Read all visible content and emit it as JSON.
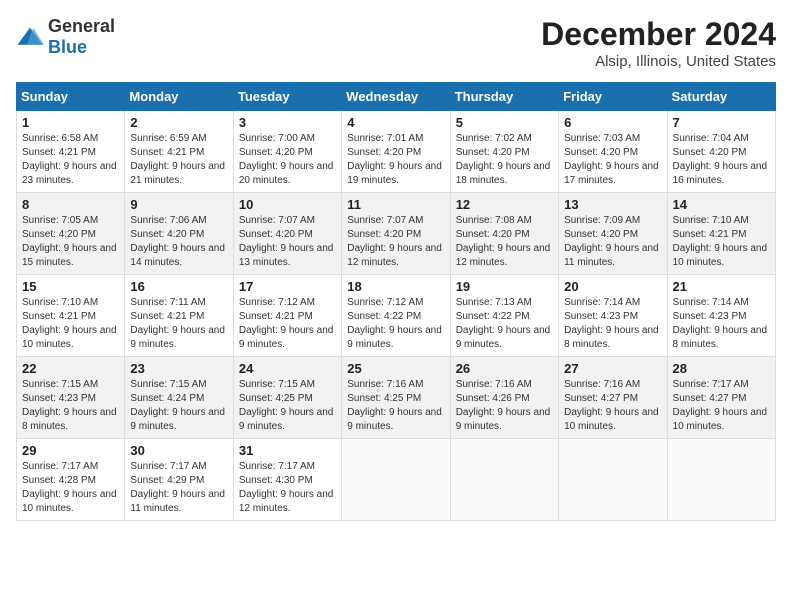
{
  "header": {
    "logo_general": "General",
    "logo_blue": "Blue",
    "month_title": "December 2024",
    "location": "Alsip, Illinois, United States"
  },
  "days_of_week": [
    "Sunday",
    "Monday",
    "Tuesday",
    "Wednesday",
    "Thursday",
    "Friday",
    "Saturday"
  ],
  "weeks": [
    [
      {
        "day": "1",
        "sunrise": "6:58 AM",
        "sunset": "4:21 PM",
        "daylight": "9 hours and 23 minutes."
      },
      {
        "day": "2",
        "sunrise": "6:59 AM",
        "sunset": "4:21 PM",
        "daylight": "9 hours and 21 minutes."
      },
      {
        "day": "3",
        "sunrise": "7:00 AM",
        "sunset": "4:20 PM",
        "daylight": "9 hours and 20 minutes."
      },
      {
        "day": "4",
        "sunrise": "7:01 AM",
        "sunset": "4:20 PM",
        "daylight": "9 hours and 19 minutes."
      },
      {
        "day": "5",
        "sunrise": "7:02 AM",
        "sunset": "4:20 PM",
        "daylight": "9 hours and 18 minutes."
      },
      {
        "day": "6",
        "sunrise": "7:03 AM",
        "sunset": "4:20 PM",
        "daylight": "9 hours and 17 minutes."
      },
      {
        "day": "7",
        "sunrise": "7:04 AM",
        "sunset": "4:20 PM",
        "daylight": "9 hours and 16 minutes."
      }
    ],
    [
      {
        "day": "8",
        "sunrise": "7:05 AM",
        "sunset": "4:20 PM",
        "daylight": "9 hours and 15 minutes."
      },
      {
        "day": "9",
        "sunrise": "7:06 AM",
        "sunset": "4:20 PM",
        "daylight": "9 hours and 14 minutes."
      },
      {
        "day": "10",
        "sunrise": "7:07 AM",
        "sunset": "4:20 PM",
        "daylight": "9 hours and 13 minutes."
      },
      {
        "day": "11",
        "sunrise": "7:07 AM",
        "sunset": "4:20 PM",
        "daylight": "9 hours and 12 minutes."
      },
      {
        "day": "12",
        "sunrise": "7:08 AM",
        "sunset": "4:20 PM",
        "daylight": "9 hours and 12 minutes."
      },
      {
        "day": "13",
        "sunrise": "7:09 AM",
        "sunset": "4:20 PM",
        "daylight": "9 hours and 11 minutes."
      },
      {
        "day": "14",
        "sunrise": "7:10 AM",
        "sunset": "4:21 PM",
        "daylight": "9 hours and 10 minutes."
      }
    ],
    [
      {
        "day": "15",
        "sunrise": "7:10 AM",
        "sunset": "4:21 PM",
        "daylight": "9 hours and 10 minutes."
      },
      {
        "day": "16",
        "sunrise": "7:11 AM",
        "sunset": "4:21 PM",
        "daylight": "9 hours and 9 minutes."
      },
      {
        "day": "17",
        "sunrise": "7:12 AM",
        "sunset": "4:21 PM",
        "daylight": "9 hours and 9 minutes."
      },
      {
        "day": "18",
        "sunrise": "7:12 AM",
        "sunset": "4:22 PM",
        "daylight": "9 hours and 9 minutes."
      },
      {
        "day": "19",
        "sunrise": "7:13 AM",
        "sunset": "4:22 PM",
        "daylight": "9 hours and 9 minutes."
      },
      {
        "day": "20",
        "sunrise": "7:14 AM",
        "sunset": "4:23 PM",
        "daylight": "9 hours and 8 minutes."
      },
      {
        "day": "21",
        "sunrise": "7:14 AM",
        "sunset": "4:23 PM",
        "daylight": "9 hours and 8 minutes."
      }
    ],
    [
      {
        "day": "22",
        "sunrise": "7:15 AM",
        "sunset": "4:23 PM",
        "daylight": "9 hours and 8 minutes."
      },
      {
        "day": "23",
        "sunrise": "7:15 AM",
        "sunset": "4:24 PM",
        "daylight": "9 hours and 9 minutes."
      },
      {
        "day": "24",
        "sunrise": "7:15 AM",
        "sunset": "4:25 PM",
        "daylight": "9 hours and 9 minutes."
      },
      {
        "day": "25",
        "sunrise": "7:16 AM",
        "sunset": "4:25 PM",
        "daylight": "9 hours and 9 minutes."
      },
      {
        "day": "26",
        "sunrise": "7:16 AM",
        "sunset": "4:26 PM",
        "daylight": "9 hours and 9 minutes."
      },
      {
        "day": "27",
        "sunrise": "7:16 AM",
        "sunset": "4:27 PM",
        "daylight": "9 hours and 10 minutes."
      },
      {
        "day": "28",
        "sunrise": "7:17 AM",
        "sunset": "4:27 PM",
        "daylight": "9 hours and 10 minutes."
      }
    ],
    [
      {
        "day": "29",
        "sunrise": "7:17 AM",
        "sunset": "4:28 PM",
        "daylight": "9 hours and 10 minutes."
      },
      {
        "day": "30",
        "sunrise": "7:17 AM",
        "sunset": "4:29 PM",
        "daylight": "9 hours and 11 minutes."
      },
      {
        "day": "31",
        "sunrise": "7:17 AM",
        "sunset": "4:30 PM",
        "daylight": "9 hours and 12 minutes."
      },
      null,
      null,
      null,
      null
    ]
  ]
}
